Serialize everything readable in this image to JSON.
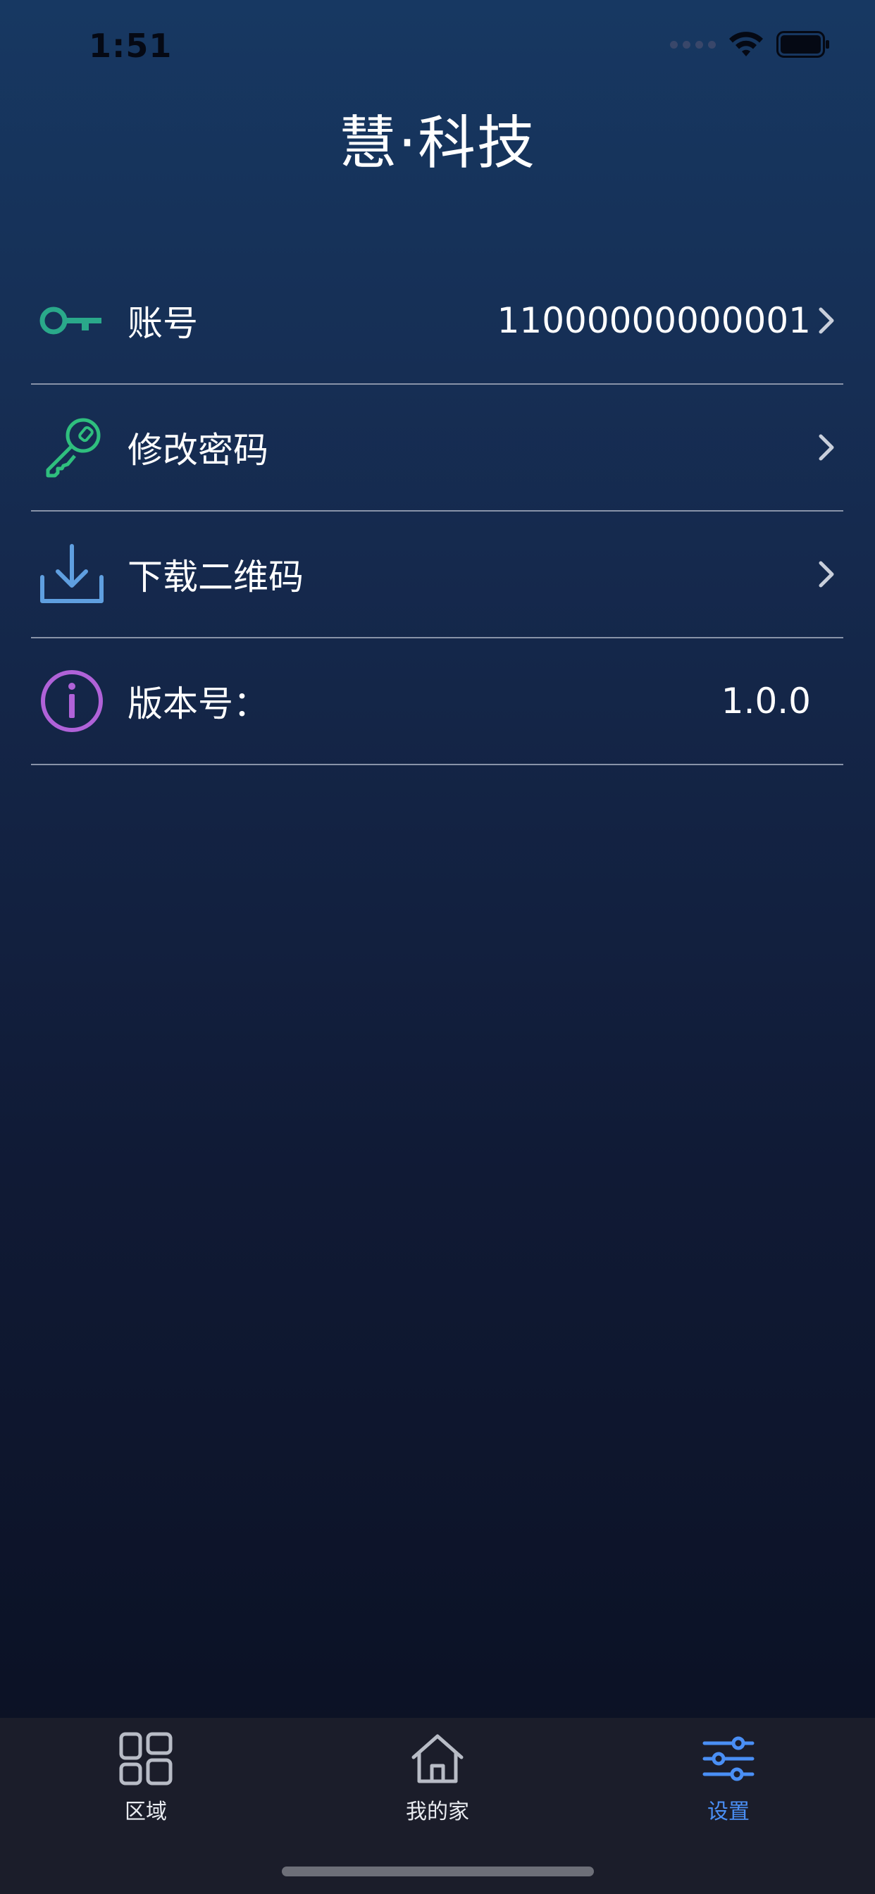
{
  "status_bar": {
    "time": "1:51"
  },
  "header": {
    "title": "慧·科技"
  },
  "settings": {
    "rows": [
      {
        "label": "账号",
        "value": "11000000000001",
        "icon": "key-icon",
        "icon_color": "#2aa98a"
      },
      {
        "label": "修改密码",
        "value": "",
        "icon": "key-angled-icon",
        "icon_color": "#2fbf7e"
      },
      {
        "label": "下载二维码",
        "value": "",
        "icon": "download-icon",
        "icon_color": "#5f9fe0"
      },
      {
        "label": "版本号：",
        "value": "1.0.0",
        "icon": "info-icon",
        "icon_color": "#b062d8"
      }
    ]
  },
  "tab_bar": {
    "tabs": [
      {
        "label": "区域",
        "icon": "grid-icon"
      },
      {
        "label": "我的家",
        "icon": "home-icon"
      },
      {
        "label": "设置",
        "icon": "sliders-icon",
        "active": true
      }
    ],
    "active_color": "#4a8ff5"
  }
}
